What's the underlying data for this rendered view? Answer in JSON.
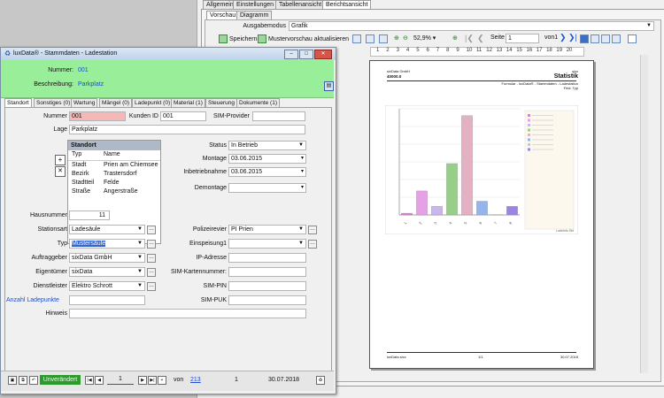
{
  "report": {
    "tabs": [
      "Allgemein",
      "Einstellungen",
      "Tabellenansicht",
      "Berichtsansicht"
    ],
    "subtabs": [
      "Vorschau",
      "Diagramm"
    ],
    "ausgabe_label": "Ausgabemodus",
    "ausgabe_value": "Grafik",
    "save_label": "Speichern",
    "preview_label": "Mustervorschau aktualisieren",
    "zoom": "52,9%",
    "page_label": "Seite",
    "page_value": "1",
    "page_total": "von1",
    "ruler": [
      "1",
      "2",
      "3",
      "4",
      "5",
      "6",
      "7",
      "8",
      "9",
      "10",
      "11",
      "12",
      "13",
      "14",
      "15",
      "16",
      "17",
      "18",
      "19",
      "20"
    ],
    "paper": {
      "company": "sixData GmbH",
      "company_sub": "40000.0",
      "brand": "sixx",
      "title": "Statistik",
      "subtitle": "Formular - luxData® - Stammdaten - Ladestation",
      "subtitle2": "Feld: Typ",
      "footer_left": "luxData sixx",
      "footer_mid": "1/1",
      "footer_right": "30.07.2018",
      "chart_caption": "LadeInfo Sbt"
    }
  },
  "chart_data": {
    "type": "bar",
    "categories": [
      "1",
      "2",
      "3",
      "4",
      "5",
      "6",
      "7",
      "8"
    ],
    "values": [
      0.5,
      7,
      2.5,
      15,
      29,
      4,
      0.1,
      2.5
    ],
    "colors": [
      "#e07ae0",
      "#e6a0e6",
      "#c9b6ea",
      "#98cf88",
      "#e2b1c4",
      "#96b4ec",
      "#c8c8c8",
      "#9c84e2"
    ],
    "ylim": [
      0,
      31
    ]
  },
  "window": {
    "title": "luxData® - Stammdaten - Ladestation",
    "nummer_label": "Nummer:",
    "nummer_value": "001",
    "beschreibung_label": "Beschreibung:",
    "beschreibung_value": "Parkplatz"
  },
  "form_tabs": [
    "Standort",
    "Sonstiges (0)",
    "Wartung",
    "Mängel (0)",
    "Ladepunkt (0)",
    "Material (1)",
    "Steuerung",
    "Dokumente (1)"
  ],
  "form": {
    "nummer_label": "Nummer",
    "nummer": "001",
    "kunden_label": "Kunden ID",
    "kunden": "001",
    "sim_provider_label": "SIM-Provider",
    "lage_label": "Lage",
    "lage": "Parkplatz",
    "standort_header": "Standort",
    "standort_cols": [
      "Typ",
      "Name"
    ],
    "standort_rows": [
      [
        "Stadt",
        "Prien am Chiemsee"
      ],
      [
        "Bezirk",
        "Trastersdorf"
      ],
      [
        "Stadtteil",
        "Felde"
      ],
      [
        "Straße",
        "Angerstraße"
      ]
    ],
    "status_label": "Status",
    "status": "In Betrieb",
    "montage_label": "Montage",
    "montage": "03.06.2015",
    "inbetrieb_label": "Inbetriebnahme",
    "inbetrieb": "03.06.2015",
    "demontage_label": "Demontage",
    "demontage": "",
    "hausnummer_label": "Hausnummer",
    "hausnummer": "11",
    "stationsart_label": "Stationsart",
    "stationsart": "Ladesäule",
    "polizei_label": "Polizeirevier",
    "polizei": "PI Prien",
    "typ_label": "Typ",
    "typ": "Mustersäule",
    "einspeisung_label": "Einspeisung1",
    "einspeisung": "",
    "auftraggeber_label": "Auftraggeber",
    "auftraggeber": "sixData GmbH",
    "ip_label": "IP-Adresse",
    "eigentuemer_label": "Eigentümer",
    "eigentuemer": "sixData",
    "simkarten_label": "SIM-Kartennummer:",
    "dienstleister_label": "Dienstleister",
    "dienstleister": "Elektro Schrott",
    "simpin_label": "SIM-PIN",
    "anzahl_label": "Anzahl Ladepunkte",
    "simpuk_label": "SIM-PUK",
    "hinweis_label": "Hinweis"
  },
  "footer": {
    "status": "Unverändert",
    "record": "1",
    "von_label": "von",
    "total": "213",
    "count": "1",
    "date": "30.07.2018"
  }
}
